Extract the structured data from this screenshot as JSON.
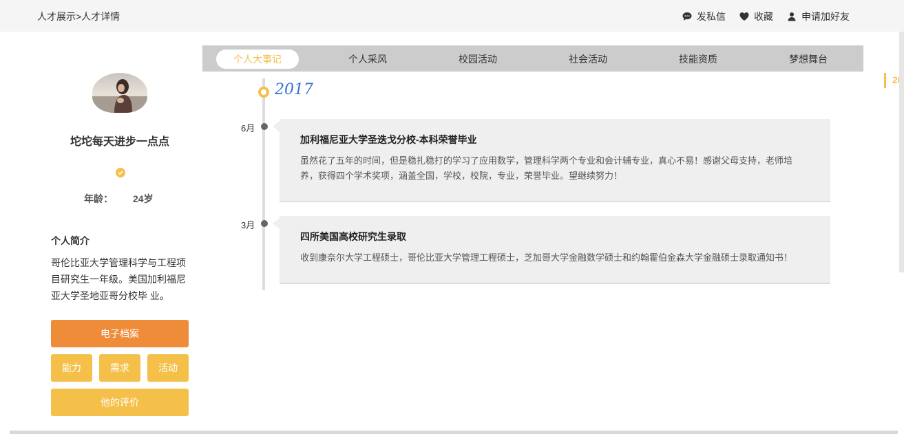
{
  "breadcrumb": "人才展示>人才详情",
  "top_actions": {
    "message": "发私信",
    "favorite": "收藏",
    "add_friend": "申请加好友"
  },
  "profile": {
    "name": "坨坨每天进步一点点",
    "age_label": "年龄：",
    "age_value": "24岁",
    "intro_title": "个人简介",
    "intro_text": "哥伦比亚大学管理科学与工程项目研究生一年级。美国加利福尼亚大学圣地亚哥分校毕 业。"
  },
  "buttons": {
    "archive": "电子档案",
    "ability": "能力",
    "need": "需求",
    "activity": "活动",
    "evaluation": "他的评价"
  },
  "tabs": [
    {
      "label": "个人大事记",
      "active": true
    },
    {
      "label": "个人采风",
      "active": false
    },
    {
      "label": "校园活动",
      "active": false
    },
    {
      "label": "社会活动",
      "active": false
    },
    {
      "label": "技能资质",
      "active": false
    },
    {
      "label": "梦想舞台",
      "active": false
    }
  ],
  "timeline": {
    "year": "2017",
    "events": [
      {
        "month": "6月",
        "title": "加利福尼亚大学圣迭戈分校-本科荣誉毕业",
        "text": "虽然花了五年的时间，但是稳扎稳打的学习了应用数学，管理科学两个专业和会计辅专业，真心不易！感谢父母支持，老师培养，获得四个学术奖项，涵盖全国，学校，校院，专业，荣誉毕业。望继续努力！"
      },
      {
        "month": "3月",
        "title": "四所美国高校研究生录取",
        "text": "收到康奈尔大学工程硕士，哥伦比亚大学管理工程硕士，芝加哥大学金融数学硕士和约翰霍伯金森大学金融硕士录取通知书！"
      }
    ]
  },
  "edge_year_fragment": "20",
  "colors": {
    "accent_yellow": "#f4c04a",
    "accent_orange": "#ef8c3a",
    "year_blue": "#3a6ed6"
  }
}
